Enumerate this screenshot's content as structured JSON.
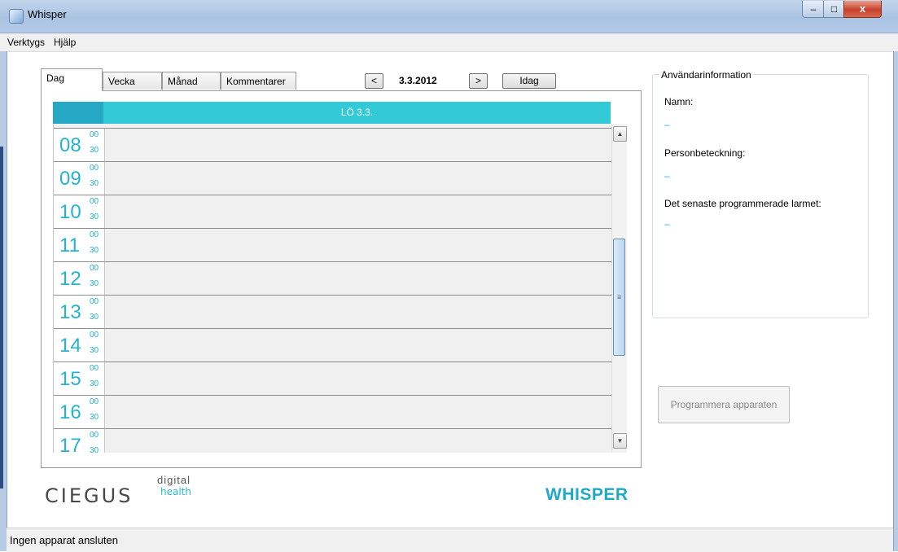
{
  "window": {
    "title": "Whisper",
    "minimize": "–",
    "maximize": "□",
    "close": "x"
  },
  "menu": [
    "Verktygs",
    "Hjälp"
  ],
  "tabs": [
    "Dag",
    "Vecka",
    "Månad",
    "Kommentarer"
  ],
  "nav": {
    "prev": "<",
    "date": "3.3.2012",
    "next": ">",
    "today": "Idag"
  },
  "calendar": {
    "day_header": "LÖ 3.3.",
    "hours": [
      "08",
      "09",
      "10",
      "11",
      "12",
      "13",
      "14",
      "15",
      "16",
      "17"
    ],
    "min_00": "00",
    "min_30": "30"
  },
  "scrollbar": {
    "up": "▲",
    "down": "▼",
    "grip": "≡"
  },
  "logos": {
    "digital": "digital",
    "ciegus": "CIEGUS",
    "health": "health",
    "whisper": "WHISPER"
  },
  "user_info": {
    "legend": "Användarinformation",
    "name_label": "Namn:",
    "name_value": "–",
    "id_label": "Personbeteckning:",
    "id_value": "–",
    "alarm_label": "Det senaste programmerade larmet:",
    "alarm_value": "–"
  },
  "program_button": "Programmera apparaten",
  "status": "Ingen apparat ansluten",
  "colors": {
    "accent": "#33cad8",
    "accent_dark": "#24a8c4",
    "text_accent": "#22b3cf",
    "whisper": "#1fa9c7"
  }
}
